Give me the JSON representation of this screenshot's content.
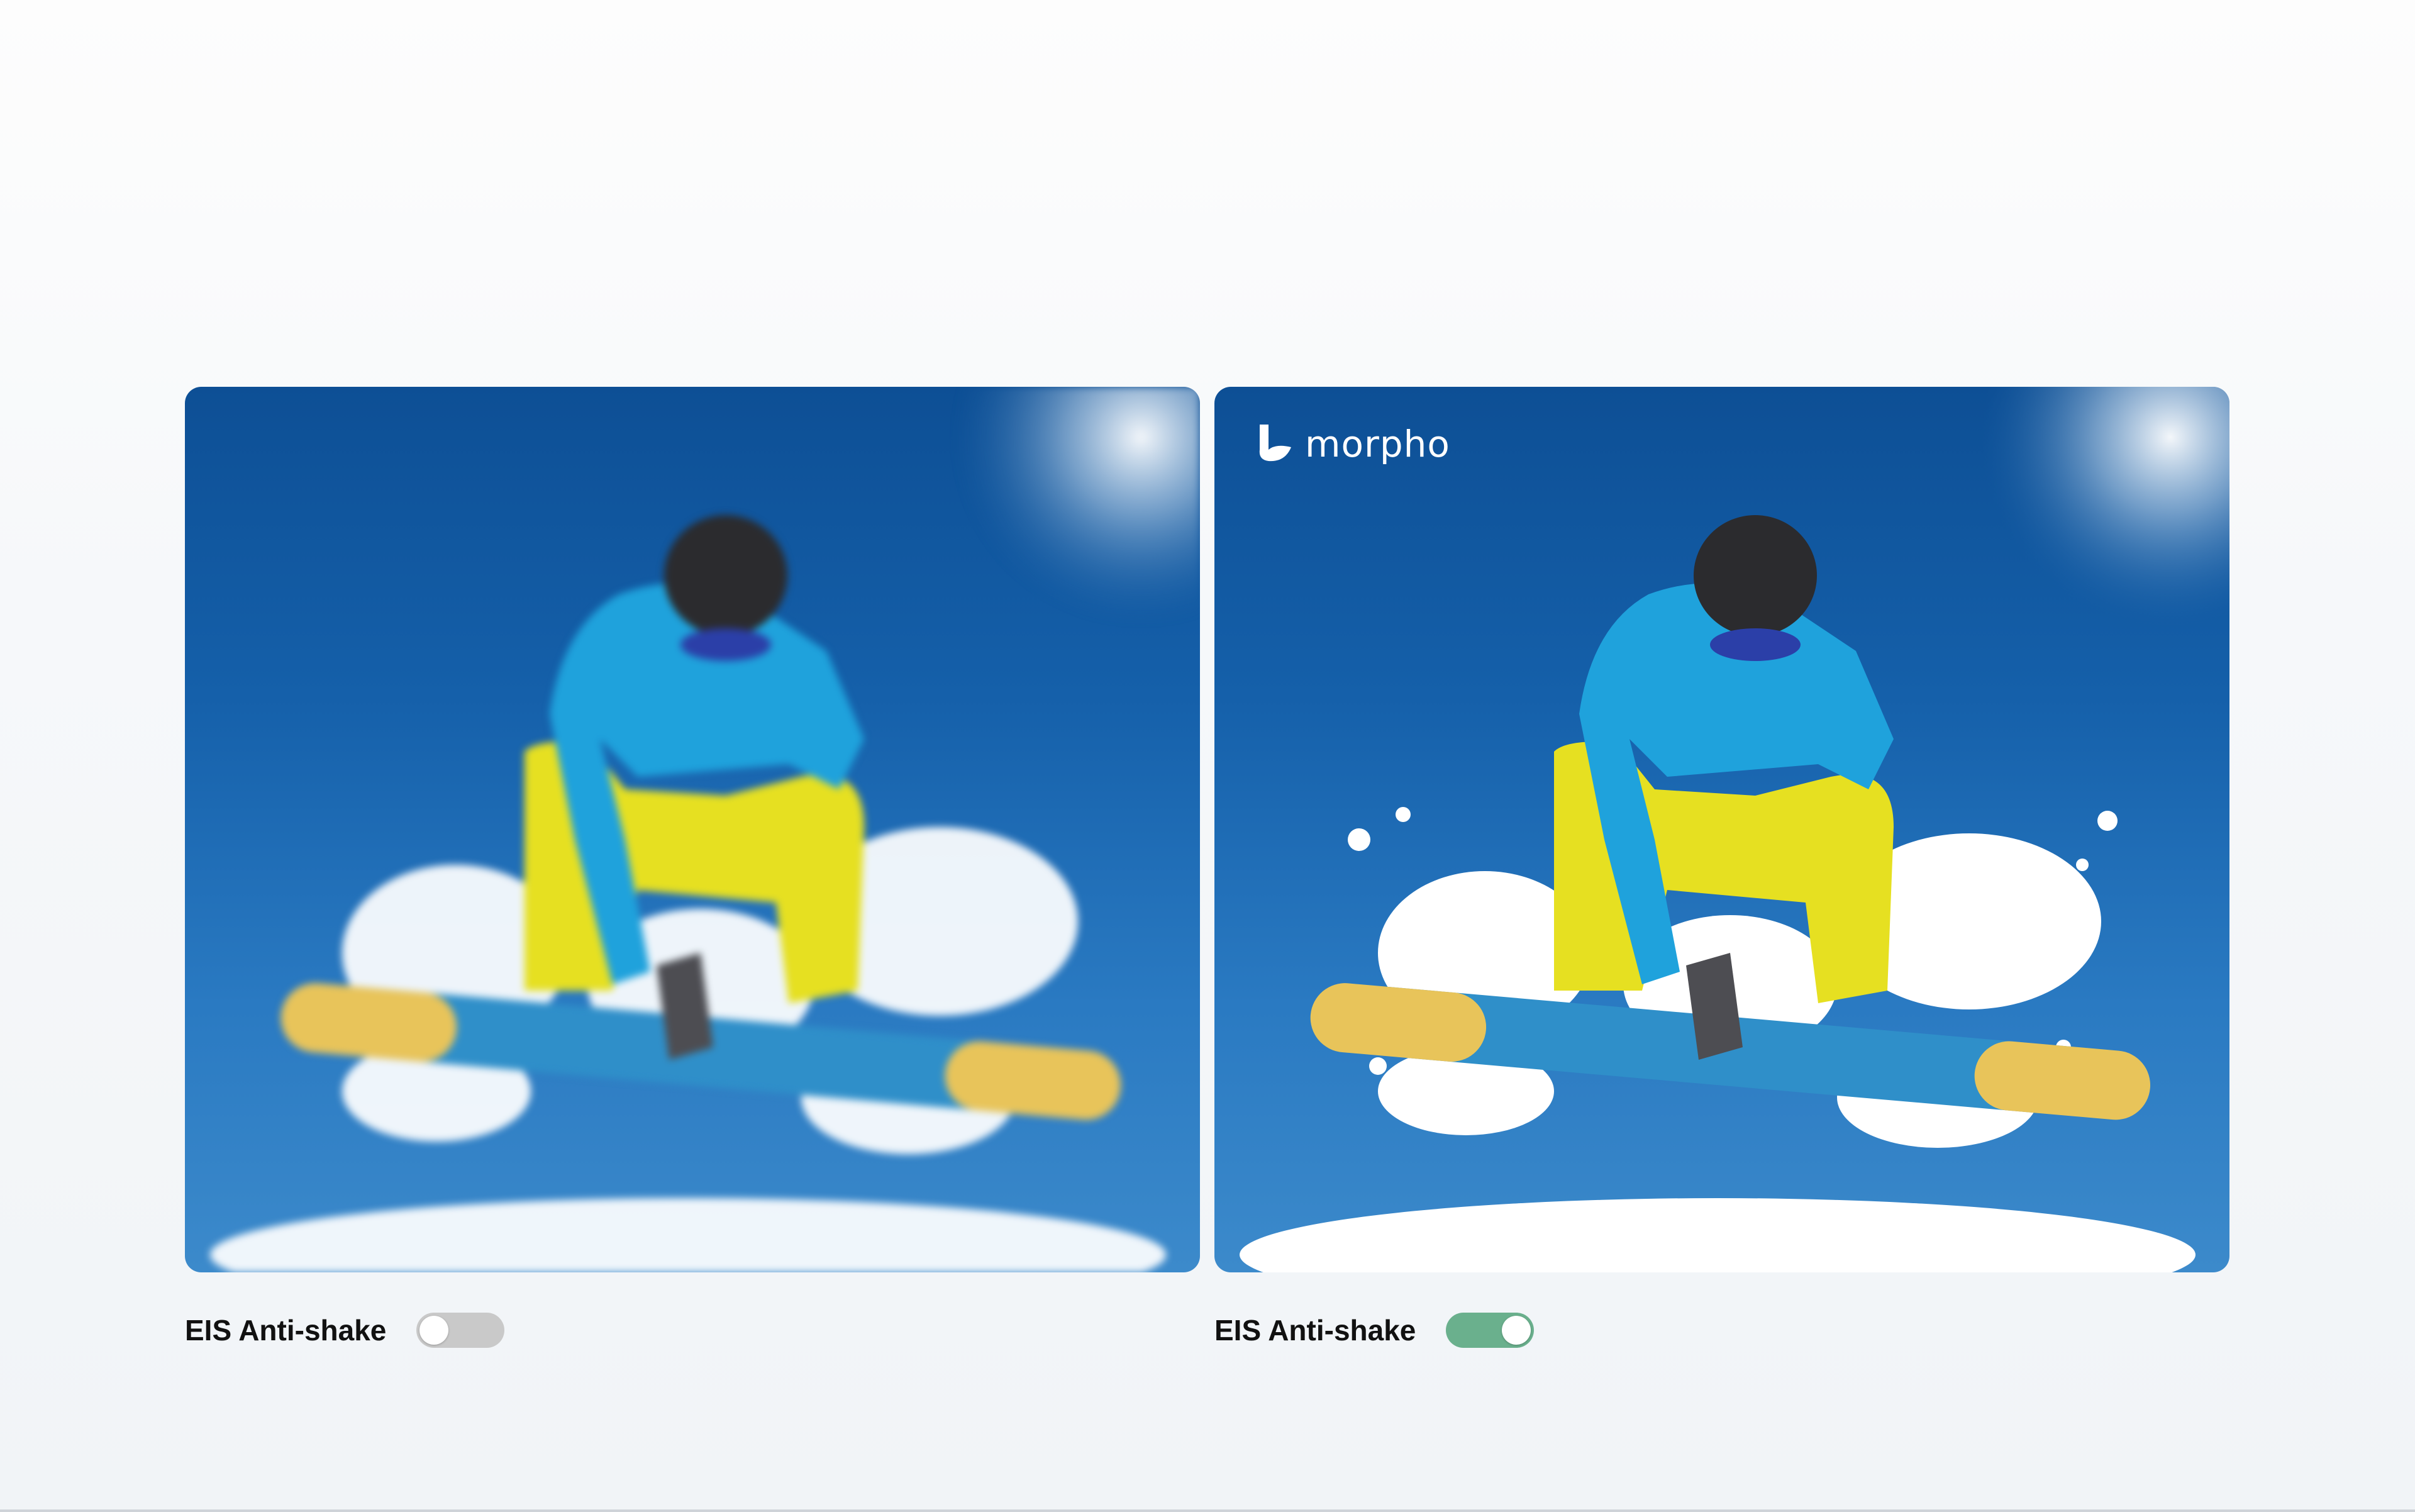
{
  "brand": {
    "name": "morpho"
  },
  "comparison": [
    {
      "id": "without",
      "setting_label": "EIS Anti-shake",
      "toggle_on": false
    },
    {
      "id": "with",
      "setting_label": "EIS Anti-shake",
      "toggle_on": true
    }
  ],
  "colors": {
    "sky": "#1560aa",
    "toggle_on": "#6ab08d",
    "toggle_off": "#c9c9c9",
    "jacket": "#1fa2dc",
    "pants": "#e6e021",
    "board_yellow": "#e8c45a",
    "board_blue": "#2f8fc9"
  },
  "icons": [
    "morpho-logo-icon",
    "toggle-switch-icon"
  ]
}
